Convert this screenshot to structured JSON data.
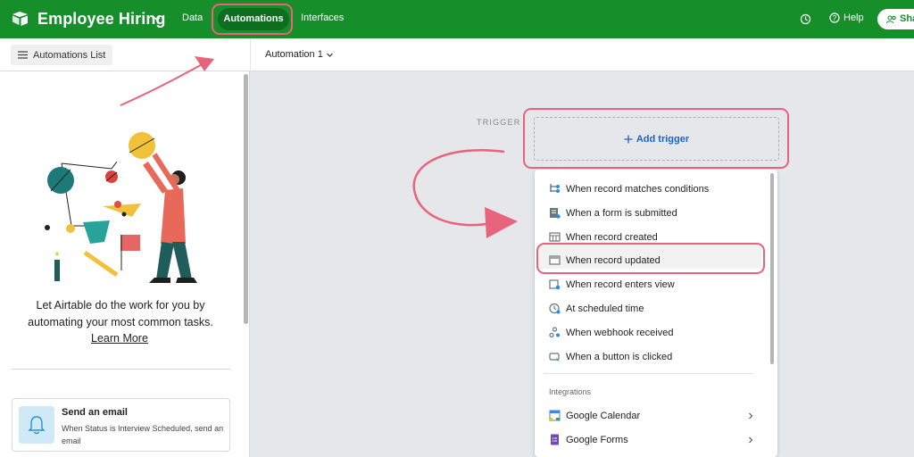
{
  "app": {
    "title": "Employee Hiring",
    "nav": {
      "data": "Data",
      "automations": "Automations",
      "interfaces": "Interfaces"
    },
    "help_label": "Help",
    "share_label": "Sha",
    "accent": "#168f2b"
  },
  "sidebar": {
    "list_button": "Automations List",
    "promo": "Let Airtable do the work for you by automating your most common tasks.",
    "learn_more": "Learn More",
    "card": {
      "title": "Send an email",
      "description": "When Status is Interview Scheduled, send an email",
      "icon": "bell-icon"
    }
  },
  "main": {
    "automation_name": "Automation 1",
    "trigger_label": "TRIGGER",
    "add_trigger": "Add trigger"
  },
  "dropdown": {
    "items": [
      {
        "label": "When record matches conditions",
        "icon": "conditions-icon"
      },
      {
        "label": "When a form is submitted",
        "icon": "form-icon"
      },
      {
        "label": "When record created",
        "icon": "record-created-icon"
      },
      {
        "label": "When record updated",
        "icon": "record-updated-icon"
      },
      {
        "label": "When record enters view",
        "icon": "view-icon"
      },
      {
        "label": "At scheduled time",
        "icon": "clock-icon"
      },
      {
        "label": "When webhook received",
        "icon": "webhook-icon"
      },
      {
        "label": "When a button is clicked",
        "icon": "button-icon"
      }
    ],
    "section_label": "Integrations",
    "integrations": [
      {
        "label": "Google Calendar",
        "icon": "google-calendar-icon"
      },
      {
        "label": "Google Forms",
        "icon": "google-forms-icon"
      }
    ]
  },
  "annotation_color": "#e8637c"
}
